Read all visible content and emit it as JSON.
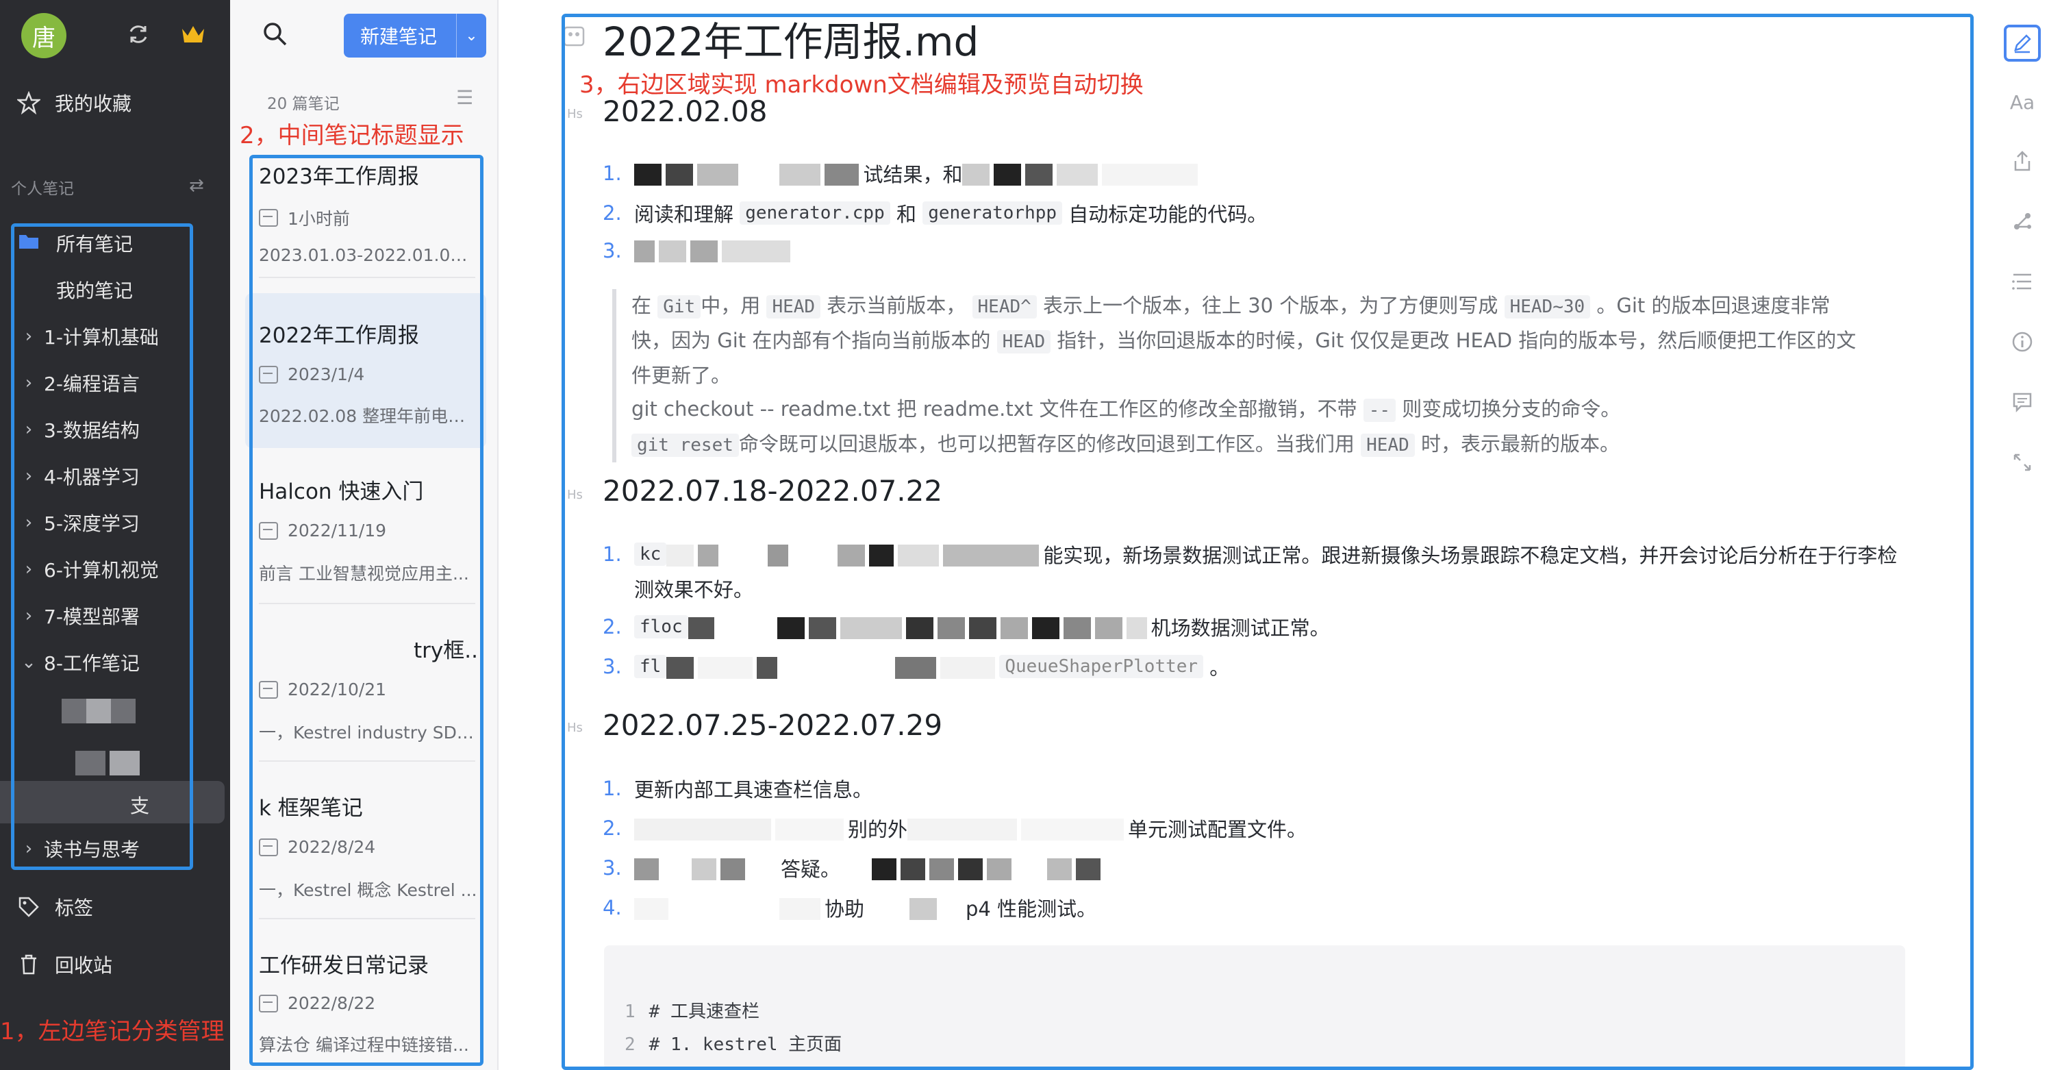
{
  "sidebar": {
    "avatar_char": "唐",
    "favorites": "我的收藏",
    "section_label": "个人笔记",
    "all_notes": "所有笔记",
    "my_notes": "我的笔记",
    "folders": [
      "1-计算机基础",
      "2-编程语言",
      "3-数据结构",
      "4-机器学习",
      "5-深度学习",
      "6-计算机视觉",
      "7-模型部署",
      "8-工作笔记"
    ],
    "selected_sub": "支",
    "reading": "读书与思考",
    "tags": "标签",
    "trash": "回收站"
  },
  "notelist": {
    "new_button": "新建笔记",
    "count": "20 篇笔记",
    "notes": [
      {
        "title": "2023年工作周报",
        "date": "1小时前",
        "snippet": "2023.01.03-2022.01.06 ..."
      },
      {
        "title": "2022年工作周报",
        "date": "2023/1/4",
        "snippet": "2022.02.08 整理年前电梯..."
      },
      {
        "title": "Halcon 快速入门",
        "date": "2022/11/19",
        "snippet": "前言 工业智慧视觉应用主..."
      },
      {
        "title": "try框...",
        "date": "2022/10/21",
        "snippet": "一，Kestrel industry SDK..."
      },
      {
        "title": "k 框架笔记",
        "date": "2022/8/24",
        "snippet": "一，Kestrel 概念 Kestrel ..."
      },
      {
        "title": "工作研发日常记录",
        "date": "2022/8/22",
        "snippet": "算法仓 编译过程中链接错..."
      }
    ]
  },
  "annotations": {
    "left": "1，左边笔记分类管理",
    "middle": "2，中间笔记标题显示",
    "right": "3，右边区域实现 markdown文档编辑及预览自动切换"
  },
  "editor": {
    "title": "2022年工作周报.md",
    "heading_marker": "Hs",
    "section1": {
      "heading": "2022.02.08",
      "item1_text": "试结果，和",
      "item2_pre": "阅读和理解",
      "item2_code1": "generator.cpp",
      "item2_mid": "和",
      "item2_code2": "generatorhpp",
      "item2_post": "自动标定功能的代码。"
    },
    "quote": {
      "l1_a": "在",
      "l1_code1": "Git",
      "l1_b": "中，用",
      "l1_code2": "HEAD",
      "l1_c": "表示当前版本，",
      "l1_code3": "HEAD^",
      "l1_d": "表示上一个版本，往上 30 个版本，为了方便则写成",
      "l1_code4": "HEAD~30",
      "l1_e": "。Git 的版本回退速度非常",
      "l2_a": "快，因为 Git 在内部有个指向当前版本的",
      "l2_code": "HEAD",
      "l2_b": "指针，当你回退版本的时候，Git 仅仅是更改 HEAD 指向的版本号，然后顺便把工作区的文",
      "l3": "件更新了。",
      "l4_a": "git checkout -- readme.txt 把 readme.txt 文件在工作区的修改全部撤销，不带",
      "l4_code": "--",
      "l4_b": "则变成切换分支的命令。",
      "l5_code1": "git reset",
      "l5_a": "命令既可以回退版本，也可以把暂存区的修改回退到工作区。当我们用",
      "l5_code2": "HEAD",
      "l5_b": "时，表示最新的版本。"
    },
    "section2": {
      "heading": "2022.07.18-2022.07.22",
      "item1_pre": "kc",
      "item1_post": "能实现，新场景数据测试正常。跟进新摄像头场景跟踪不稳定文档，并开会讨论后分析在于行李检",
      "item1_wrap": "测效果不好。",
      "item2_code": "floc",
      "item2_post": "机场数据测试正常。",
      "item3_code": "fl",
      "item3_post": "QueueShaperPlotter",
      "item3_end": "。"
    },
    "section3": {
      "heading": "2022.07.25-2022.07.29",
      "item1": "更新内部工具速查栏信息。",
      "item2_mid": "别的外",
      "item2_post": "单元测试配置文件。",
      "item3_mid": "答疑。",
      "item4_a": "协助",
      "item4_b": "p4 性能测试。"
    },
    "code_lines": [
      "# 工具速查栏",
      "# 1. kestrel 主页面"
    ]
  },
  "toolbar": {
    "font_label": "Aa"
  }
}
